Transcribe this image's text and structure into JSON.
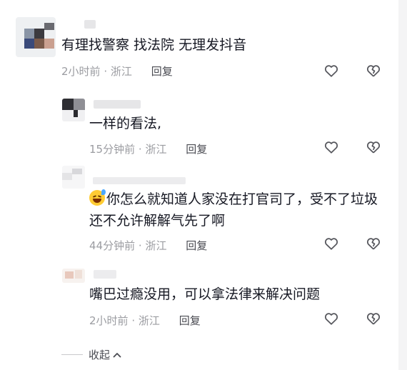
{
  "comments": [
    {
      "text": "有理找警察 找法院  无理发抖音",
      "time": "2小时前",
      "location": "浙江",
      "reply_label": "回复"
    },
    {
      "text": "一样的看法,",
      "time": "15分钟前",
      "location": "浙江",
      "reply_label": "回复"
    },
    {
      "text": "你怎么就知道人家没在打官司了，受不了垃圾还不允许解解气先了啊",
      "time": "44分钟前",
      "location": "浙江",
      "reply_label": "回复"
    },
    {
      "text": "嘴巴过瘾没用，可以拿法律来解决问题",
      "time": "2小时前",
      "location": "浙江",
      "reply_label": "回复"
    }
  ],
  "separator": "·",
  "collapse_label": "收起",
  "icons": {
    "like": "heart-outline-icon",
    "dislike": "broken-heart-icon",
    "collapse": "chevron-up-icon"
  }
}
